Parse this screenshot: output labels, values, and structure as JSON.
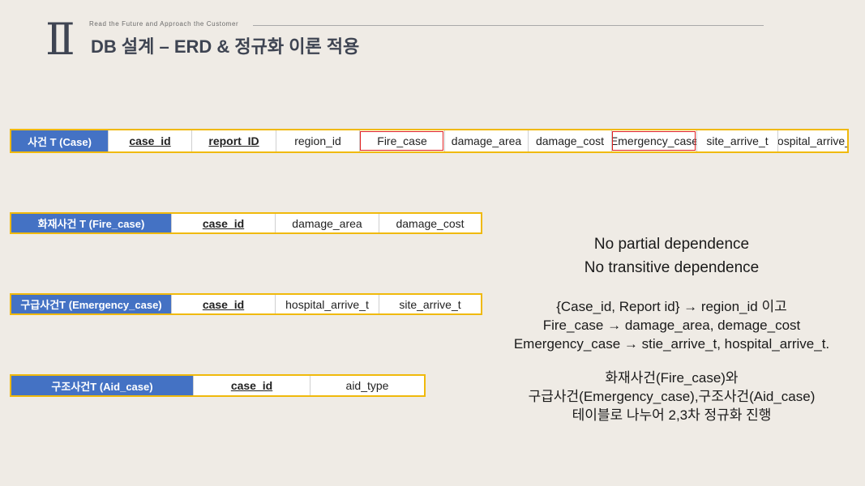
{
  "header": {
    "numeral": "Ⅱ",
    "tagline": "Read the Future and Approach the Customer",
    "title": "DB 설계 – ERD & 정규화 이론 적용"
  },
  "tables": {
    "case": {
      "name": "사건 T (Case)",
      "columns": [
        "case_id",
        "report_ID",
        "region_id",
        "Fire_case",
        "damage_area",
        "damage_cost",
        "Emergency_case",
        "site_arrive_t",
        "hospital_arrive_t"
      ]
    },
    "fire": {
      "name": "화재사건 T (Fire_case)",
      "columns": [
        "case_id",
        "damage_area",
        "damage_cost"
      ]
    },
    "emergency": {
      "name": "구급사건T (Emergency_case)",
      "columns": [
        "case_id",
        "hospital_arrive_t",
        "site_arrive_t"
      ]
    },
    "aid": {
      "name": "구조사건T (Aid_case)",
      "columns": [
        "case_id",
        "aid_type"
      ]
    }
  },
  "notes": {
    "dependence": [
      "No partial dependence",
      "No transitive dependence"
    ],
    "functional_dependencies": [
      "{Case_id, Report id} → region_id 이고",
      "Fire_case → damage_area, demage_cost",
      "Emergency_case → stie_arrive_t, hospital_arrive_t."
    ],
    "normalization": [
      "화재사건(Fire_case)와",
      "구급사건(Emergency_case),구조사건(Aid_case)",
      "테이블로 나누어 2,3차 정규화 진행"
    ]
  },
  "colors": {
    "header_fill": "#4472C4",
    "table_border": "#F0B90B",
    "highlight": "#E02020",
    "title": "#3E4452"
  }
}
